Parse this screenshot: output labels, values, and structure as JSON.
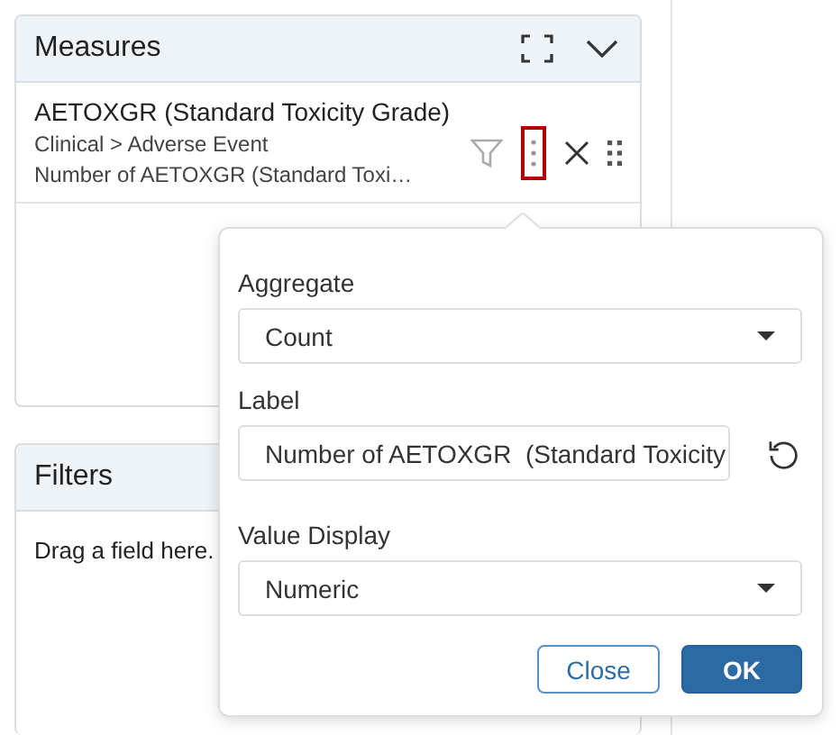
{
  "measures": {
    "title": "Measures",
    "items": [
      {
        "name": "AETOXGR (Standard Toxicity Grade)",
        "path": "Clinical > Adverse Event",
        "label": "Number of AETOXGR (Standard Toxi…",
        "menu_highlighted": true
      }
    ]
  },
  "filters": {
    "title": "Filters",
    "empty_text": "Drag a field here."
  },
  "popover": {
    "fields": [
      {
        "kind": "select",
        "label": "Aggregate",
        "value": "Count"
      },
      {
        "kind": "text",
        "label": "Label",
        "value": "Number of AETOXGR  (Standard Toxicity"
      },
      {
        "kind": "select",
        "label": "Value Display",
        "value": "Numeric"
      }
    ],
    "buttons": [
      {
        "label": "Close",
        "kind": "secondary"
      },
      {
        "label": "OK",
        "kind": "primary"
      }
    ]
  }
}
